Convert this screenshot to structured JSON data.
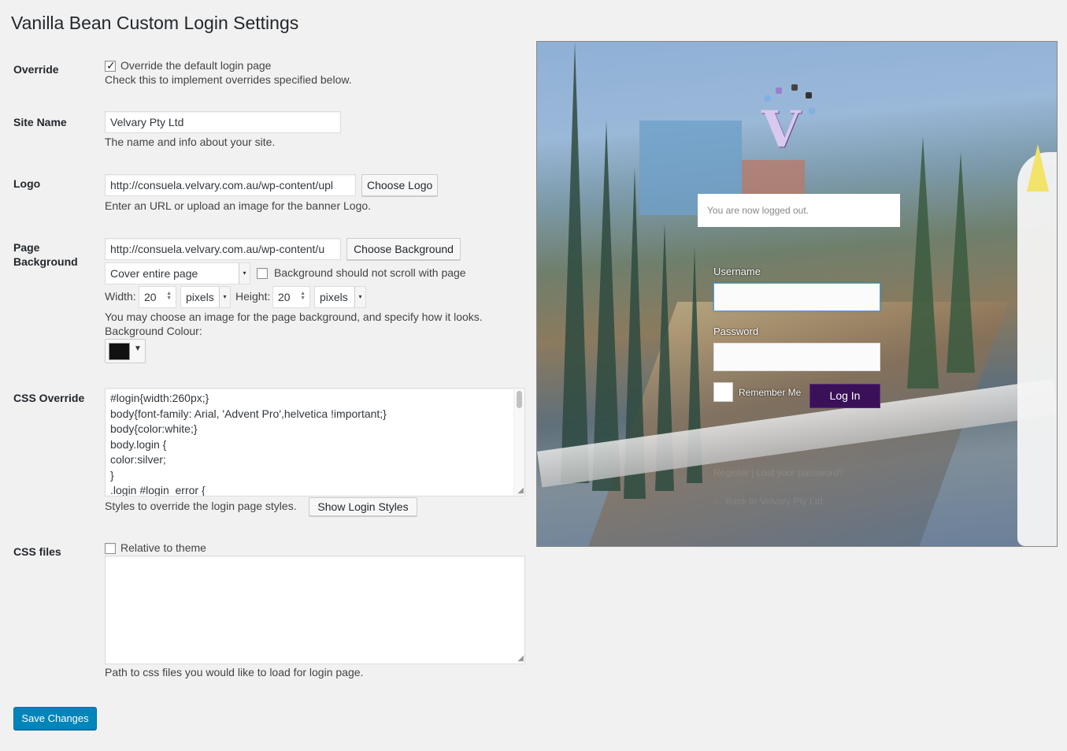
{
  "page_title": "Vanilla Bean Custom Login Settings",
  "override": {
    "label": "Override",
    "checkbox_label": "Override the default login page",
    "checked": true,
    "help": "Check this to implement overrides specified below."
  },
  "site_name": {
    "label": "Site Name",
    "value": "Velvary Pty Ltd",
    "help": "The name and info about your site."
  },
  "logo": {
    "label": "Logo",
    "value": "http://consuela.velvary.com.au/wp-content/upl",
    "button": "Choose Logo",
    "help": "Enter an URL or upload an image for the banner Logo."
  },
  "background": {
    "label_line1": "Page",
    "label_line2": "Background",
    "value": "http://consuela.velvary.com.au/wp-content/u",
    "button": "Choose Background",
    "size_mode": "Cover entire page",
    "no_scroll_label": "Background should not scroll with page",
    "no_scroll_checked": false,
    "width_label": "Width:",
    "width_value": "20",
    "width_unit": "pixels",
    "height_label": "Height:",
    "height_value": "20",
    "height_unit": "pixels",
    "help": "You may choose an image for the page background, and specify how it looks.",
    "colour_label": "Background Colour:",
    "colour_value": "#111111"
  },
  "css_override": {
    "label": "CSS Override",
    "lines": [
      "#login{width:260px;}",
      "body{font-family: Arial, 'Advent Pro',helvetica !important;}",
      "body{color:white;}",
      "body.login {",
      "color:silver;",
      "}",
      ".login #login_error {"
    ],
    "help": "Styles to override the login page styles.",
    "button": "Show Login Styles"
  },
  "css_files": {
    "label": "CSS files",
    "relative_label": "Relative to theme",
    "relative_checked": false,
    "value": "",
    "help": "Path to css files you would like to load for login page."
  },
  "save_button": "Save Changes",
  "preview": {
    "message": "You are now logged out.",
    "username_label": "Username",
    "password_label": "Password",
    "remember_label": "Remember Me",
    "login_button": "Log In",
    "links": "Register | Lost your password?",
    "back_link": "← Back to Velvary Pty Ltd",
    "login_button_color": "#3a1158"
  }
}
